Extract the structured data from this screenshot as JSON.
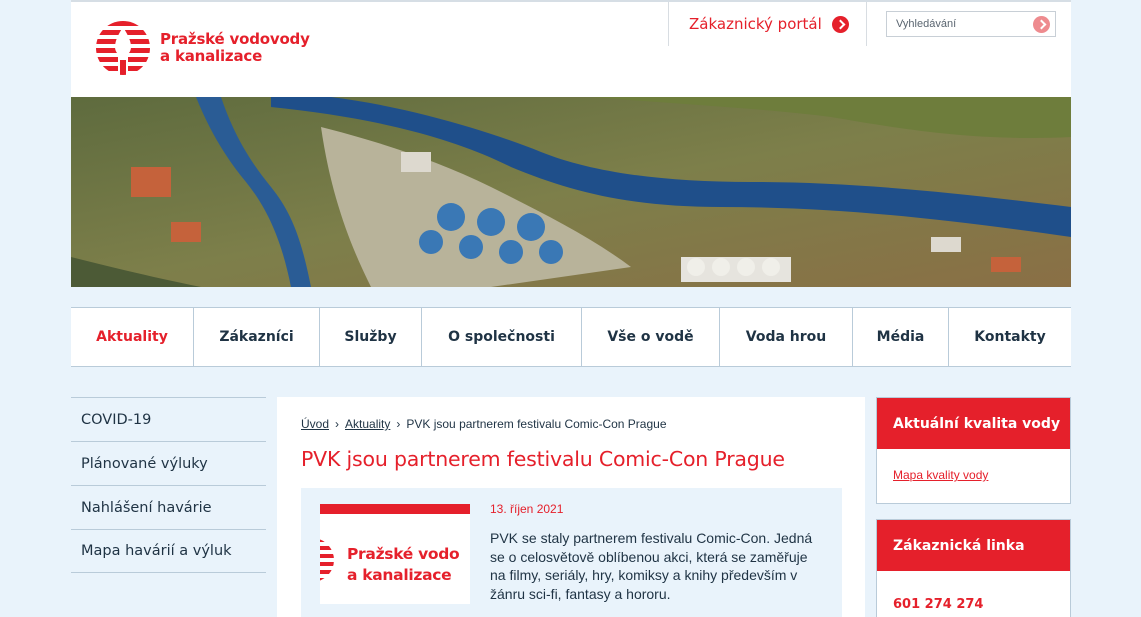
{
  "header": {
    "logo_line1": "Pražské vodovody",
    "logo_line2": "a kanalizace",
    "portal_label": "Zákaznický portál",
    "search_placeholder": "Vyhledávání"
  },
  "nav": {
    "items": [
      {
        "label": "Aktuality",
        "active": true
      },
      {
        "label": "Zákazníci"
      },
      {
        "label": "Služby"
      },
      {
        "label": "O společnosti"
      },
      {
        "label": "Vše o vodě"
      },
      {
        "label": "Voda hrou"
      },
      {
        "label": "Média"
      },
      {
        "label": "Kontakty"
      }
    ]
  },
  "sidebar": {
    "items": [
      {
        "label": "COVID-19"
      },
      {
        "label": "Plánované výluky"
      },
      {
        "label": "Nahlášení havárie"
      },
      {
        "label": "Mapa havárií a výluk"
      }
    ]
  },
  "breadcrumb": {
    "home": "Úvod",
    "section": "Aktuality",
    "current": "PVK jsou partnerem festivalu Comic-Con Prague",
    "separator": "›"
  },
  "article": {
    "title": "PVK jsou partnerem festivalu Comic-Con Prague",
    "date": "13. říjen 2021",
    "text": "PVK se staly partnerem festivalu Comic-Con.  Jedná se o celosvětově oblíbenou akci, která se zaměřuje na filmy, seriály, hry, komiksy a knihy především v žánru sci-fi, fantasy a hororu.",
    "thumb_line1": "Pražské vodo",
    "thumb_line2": "a kanalizace"
  },
  "right": {
    "quality_title": "Aktuální kvalita vody",
    "quality_link": "Mapa kvality vody",
    "hotline_title": "Zákaznická linka",
    "hotline_phone": "601 274 274"
  },
  "colors": {
    "brand_red": "#e5202b",
    "text_dark": "#1f3344",
    "page_bg": "#e9f3fb"
  }
}
